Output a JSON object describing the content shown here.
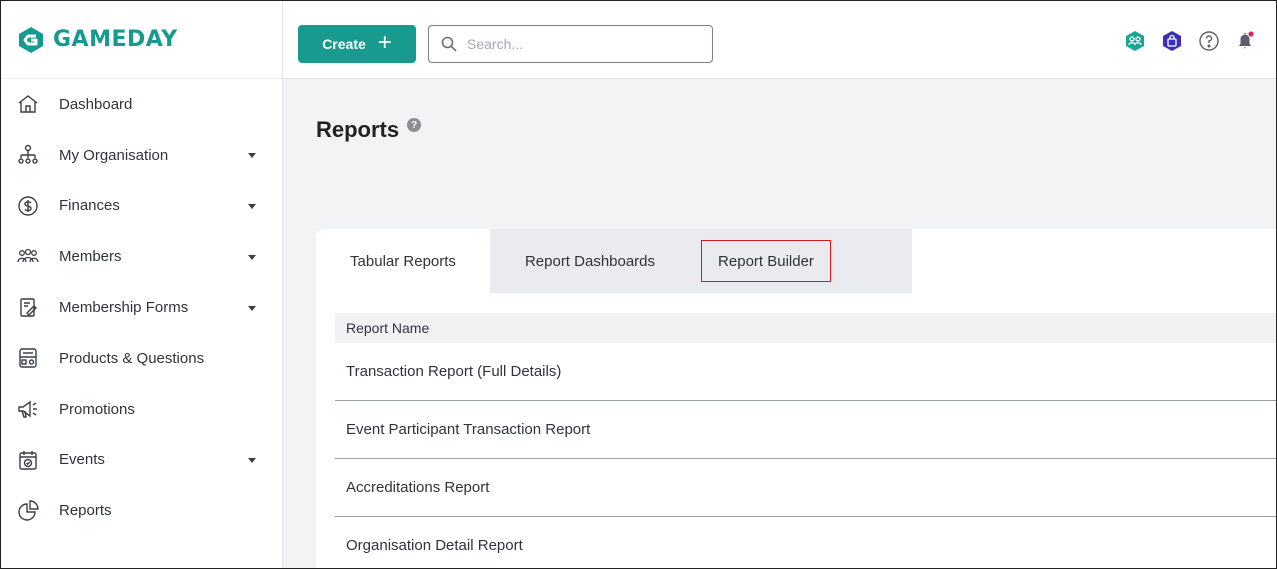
{
  "brand": {
    "name": "GAMEDAY",
    "color": "#159a8f"
  },
  "sidebar": {
    "items": [
      {
        "label": "Dashboard",
        "icon": "home-icon",
        "expandable": false
      },
      {
        "label": "My Organisation",
        "icon": "org-chart-icon",
        "expandable": true
      },
      {
        "label": "Finances",
        "icon": "dollar-circle-icon",
        "expandable": true
      },
      {
        "label": "Members",
        "icon": "members-icon",
        "expandable": true
      },
      {
        "label": "Membership Forms",
        "icon": "form-icon",
        "expandable": true
      },
      {
        "label": "Products & Questions",
        "icon": "products-icon",
        "expandable": false
      },
      {
        "label": "Promotions",
        "icon": "megaphone-icon",
        "expandable": false
      },
      {
        "label": "Events",
        "icon": "calendar-icon",
        "expandable": true
      },
      {
        "label": "Reports",
        "icon": "pie-chart-icon",
        "expandable": false
      }
    ]
  },
  "header": {
    "create_label": "Create",
    "search_placeholder": "Search...",
    "accent": "#199a8f"
  },
  "page": {
    "title": "Reports",
    "help": "?"
  },
  "tabs": [
    {
      "label": "Tabular Reports",
      "active": true
    },
    {
      "label": "Report Dashboards",
      "active": false
    },
    {
      "label": "Report Builder",
      "active": false,
      "highlighted": true
    }
  ],
  "table": {
    "header": "Report Name",
    "rows": [
      "Transaction Report (Full Details)",
      "Event Participant Transaction Report",
      "Accreditations Report",
      "Organisation Detail Report"
    ]
  }
}
